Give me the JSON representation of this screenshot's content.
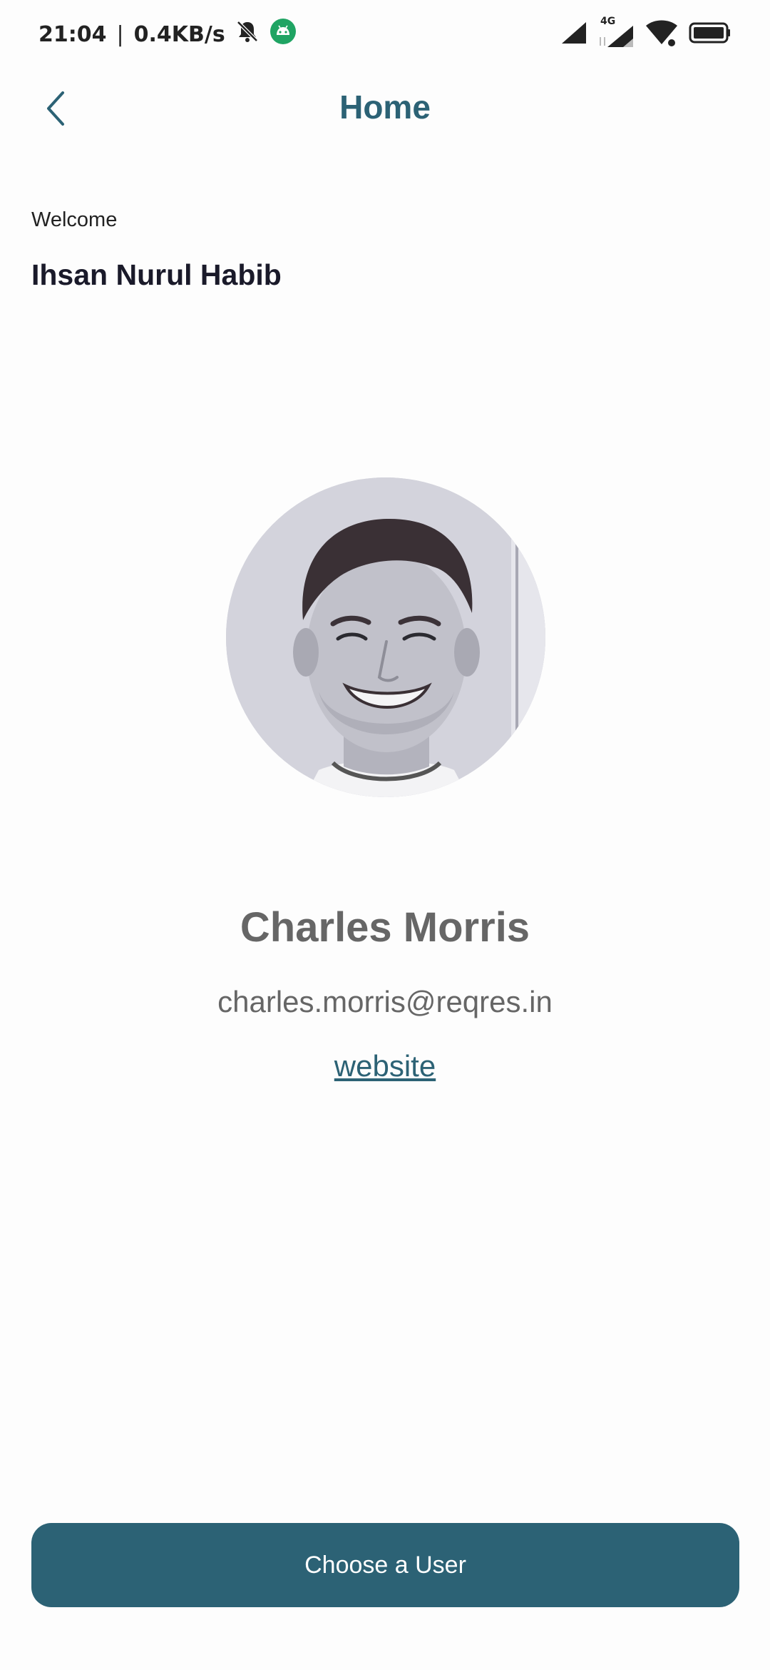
{
  "status_bar": {
    "time": "21:04",
    "separator": "|",
    "network_speed": "0.4KB/s",
    "network_type": "4G",
    "icons": [
      "bell-muted-icon",
      "android-icon",
      "signal-icon",
      "signal-4g-icon",
      "wifi-icon",
      "battery-icon"
    ],
    "android_icon_color": "#1fa463"
  },
  "header": {
    "back_icon": "chevron-left-icon",
    "title": "Home"
  },
  "welcome": {
    "label": "Welcome",
    "name": "Ihsan Nurul Habib"
  },
  "profile": {
    "avatar": "user-avatar-photo",
    "name": "Charles Morris",
    "email": "charles.morris@reqres.in",
    "website_label": "website"
  },
  "actions": {
    "choose_user_label": "Choose a User"
  },
  "colors": {
    "accent": "#2c6275",
    "text_secondary": "#666666",
    "background": "#fdfdfd"
  }
}
